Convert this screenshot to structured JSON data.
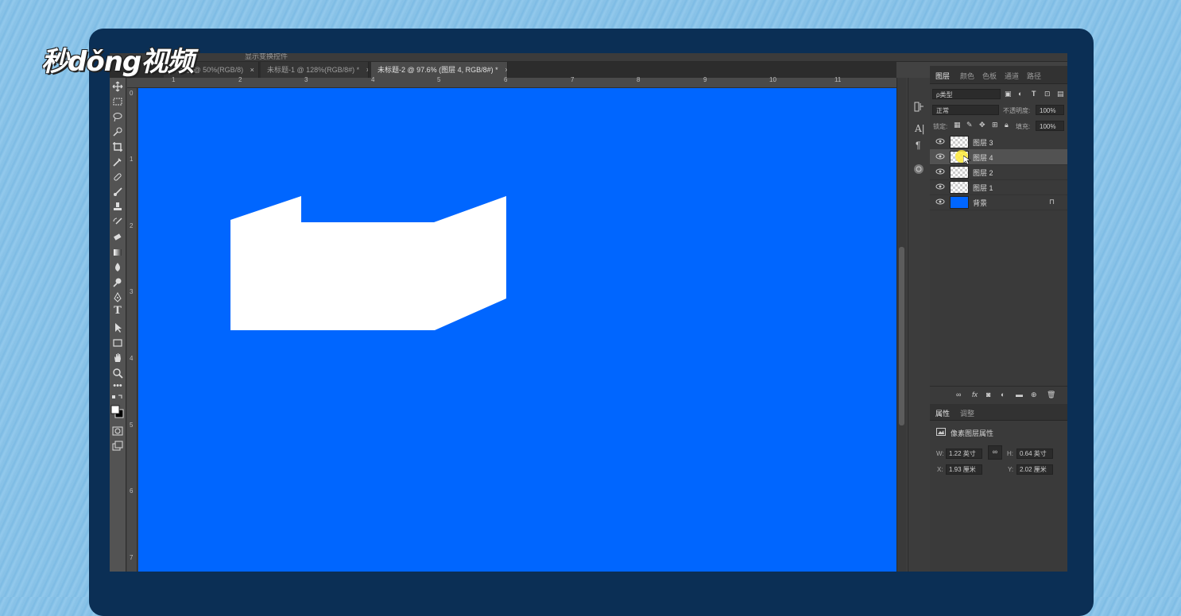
{
  "brand": {
    "logo_text": "秒dǒng视频"
  },
  "options_bar": {
    "label": "显示变换控件"
  },
  "document_tabs": [
    {
      "label": "未标题 @ 50%(RGB/8)",
      "close": "×",
      "active": false
    },
    {
      "label": "未标题-1 @ 128%(RGB/8#) *",
      "close": "×",
      "active": false
    },
    {
      "label": "未标题-2 @ 97.6% (图层 4, RGB/8#) *",
      "close": "×",
      "active": true
    }
  ],
  "rulers": {
    "top_ticks": [
      "1",
      "2",
      "3",
      "4",
      "5",
      "6",
      "7",
      "8",
      "9",
      "10",
      "11"
    ],
    "left_ticks": [
      "0",
      "1",
      "2",
      "3",
      "4",
      "5",
      "6",
      "7"
    ]
  },
  "canvas": {
    "background_color": "#0066ff",
    "shape_color": "#ffffff"
  },
  "layers_panel": {
    "tabs": [
      "图层",
      "颜色",
      "色板",
      "通道",
      "路径"
    ],
    "filter_label": "ρ类型",
    "blend_mode": "正常",
    "opacity_label": "不透明度:",
    "opacity_value": "100%",
    "lock_label": "锁定:",
    "fill_label": "填充:",
    "fill_value": "100%",
    "layers": [
      {
        "name": "图层 3",
        "selected": false,
        "thumb": "transparent",
        "locked": false
      },
      {
        "name": "图层 4",
        "selected": true,
        "thumb": "transparent",
        "locked": false
      },
      {
        "name": "图层 2",
        "selected": false,
        "thumb": "transparent",
        "locked": false
      },
      {
        "name": "图层 1",
        "selected": false,
        "thumb": "transparent",
        "locked": false
      },
      {
        "name": "背景",
        "selected": false,
        "thumb": "blue",
        "locked": true
      }
    ],
    "footer_icons": [
      "link-icon",
      "fx-icon",
      "mask-icon",
      "adjustment-icon",
      "folder-icon",
      "new-layer-icon",
      "trash-icon"
    ],
    "footer_fx": "fx"
  },
  "properties_panel": {
    "tabs": [
      "属性",
      "调整"
    ],
    "section_title": "像素图层属性",
    "w_label": "W:",
    "w_value": "1.22 英寸",
    "h_label": "H:",
    "h_value": "0.64 英寸",
    "x_label": "X:",
    "x_value": "1.93 厘米",
    "y_label": "Y:",
    "y_value": "2.02 厘米"
  }
}
